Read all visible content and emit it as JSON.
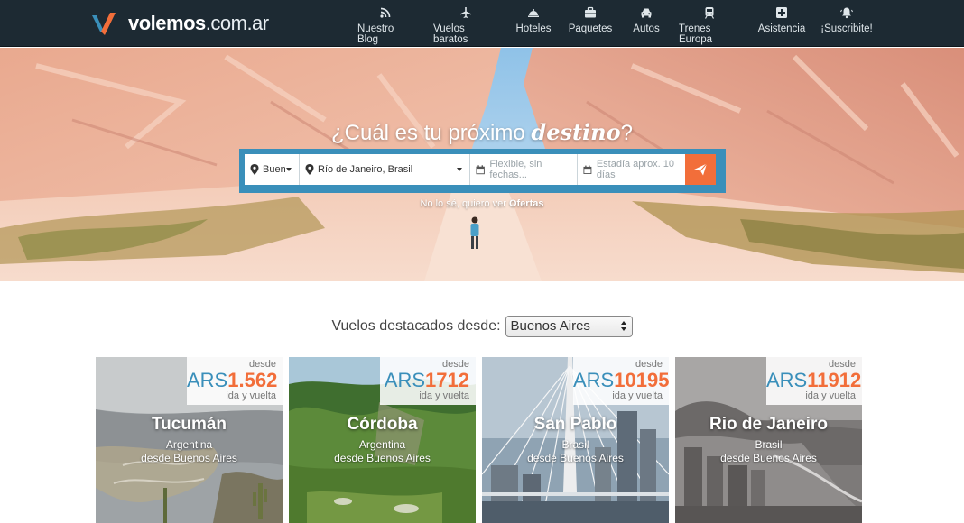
{
  "brand": {
    "name": "volemos",
    "tld": ".com.ar"
  },
  "colors": {
    "nav_bg": "#1d2a33",
    "accent_blue": "#3a8fba",
    "accent_orange": "#f26e3a"
  },
  "nav": {
    "items": [
      {
        "label": "Nuestro Blog",
        "icon": "rss-icon"
      },
      {
        "label": "Vuelos baratos",
        "icon": "plane-icon"
      },
      {
        "label": "Hoteles",
        "icon": "bell-hotel-icon"
      },
      {
        "label": "Paquetes",
        "icon": "briefcase-icon"
      },
      {
        "label": "Autos",
        "icon": "car-icon"
      },
      {
        "label": "Trenes Europa",
        "icon": "train-icon"
      },
      {
        "label": "Asistencia",
        "icon": "medical-plus-icon"
      },
      {
        "label": "¡Suscribite!",
        "icon": "bell-ring-icon"
      }
    ]
  },
  "hero": {
    "title_pre": "¿Cuál es tu próximo",
    "title_em": "destino",
    "title_post": "?",
    "search": {
      "origin_value": "Buenos Aires",
      "destination_value": "Río de Janeiro, Brasil",
      "dates_placeholder": "Flexible, sin fechas...",
      "stay_placeholder": "Estadía aprox. 10 días"
    },
    "note_pre": "No lo sé, quiero ver",
    "note_link": "Ofertas"
  },
  "featured": {
    "label": "Vuelos destacados desde:",
    "selected_origin": "Buenos Aires"
  },
  "cards": [
    {
      "from_label": "desde",
      "currency": "ARS",
      "price": "1.562",
      "trip_type": "ida y vuelta",
      "city": "Tucumán",
      "country": "Argentina",
      "origin": "desde Buenos Aires"
    },
    {
      "from_label": "desde",
      "currency": "ARS",
      "price": "1712",
      "trip_type": "ida y vuelta",
      "city": "Córdoba",
      "country": "Argentina",
      "origin": "desde Buenos Aires"
    },
    {
      "from_label": "desde",
      "currency": "ARS",
      "price": "10195",
      "trip_type": "ida y vuelta",
      "city": "San Pablo",
      "country": "Brasil",
      "origin": "desde Buenos Aires"
    },
    {
      "from_label": "desde",
      "currency": "ARS",
      "price": "11912",
      "trip_type": "ida y vuelta",
      "city": "Rio de Janeiro",
      "country": "Brasil",
      "origin": "desde Buenos Aires"
    }
  ]
}
